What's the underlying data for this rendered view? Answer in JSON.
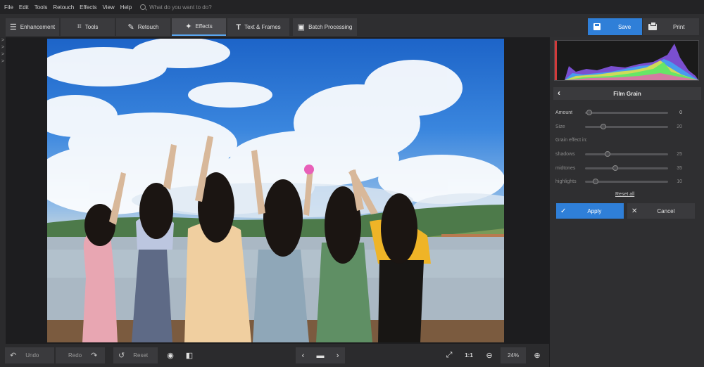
{
  "menu": {
    "items": [
      "File",
      "Edit",
      "Tools",
      "Retouch",
      "Effects",
      "View",
      "Help"
    ],
    "search_placeholder": "What do you want to do?"
  },
  "tabs": [
    {
      "label": "Enhancement",
      "icon": "sliders-icon"
    },
    {
      "label": "Tools",
      "icon": "crop-icon"
    },
    {
      "label": "Retouch",
      "icon": "brush-icon"
    },
    {
      "label": "Effects",
      "icon": "magic-wand-icon",
      "active": true
    },
    {
      "label": "Text & Frames",
      "icon": "text-icon"
    },
    {
      "label": "Batch Processing",
      "icon": "images-icon"
    }
  ],
  "actions": {
    "save": "Save",
    "print": "Print"
  },
  "colors": {
    "accent": "#2f7fd8",
    "panel": "#2f2f31",
    "toolbar": "#2e2e30"
  },
  "bottom": {
    "undo": "Undo",
    "redo": "Redo",
    "reset": "Reset",
    "ratio": "1:1",
    "zoom": "24%"
  },
  "panel": {
    "title": "Film Grain",
    "amount": {
      "label": "Amount",
      "value": "0",
      "fraction": 0.02
    },
    "size": {
      "label": "Size",
      "value": "20",
      "fraction": 0.2
    },
    "grain_effect_label": "Grain effect in:",
    "shadows": {
      "label": "shadows",
      "value": "25",
      "fraction": 0.25
    },
    "midtones": {
      "label": "midtones",
      "value": "35",
      "fraction": 0.35
    },
    "highlights": {
      "label": "highlights",
      "value": "10",
      "fraction": 0.1
    },
    "reset_all": "Reset all",
    "apply": "Apply",
    "cancel": "Cancel"
  }
}
